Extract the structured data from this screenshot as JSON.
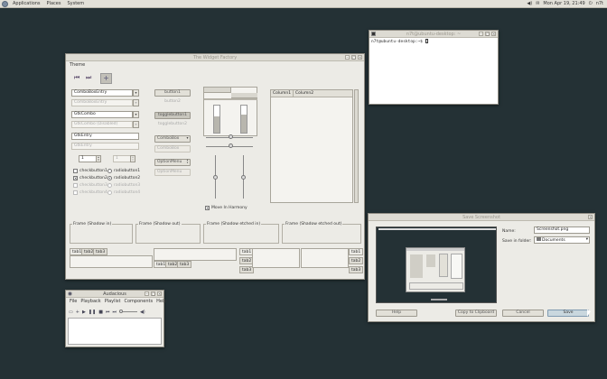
{
  "panel": {
    "menus": [
      "Applications",
      "Places",
      "System"
    ],
    "clock": "Mon Apr 19, 21:49",
    "user": "n7t"
  },
  "widget_factory": {
    "title": "The Widget Factory",
    "menu": "Theme",
    "combo_entry": "ComboBoxEntry",
    "combo_entry_dis": "ComboBoxEntry",
    "gtk_combo": "GtkCombo",
    "gtk_combo_dis": "GtkCombo (Disabled)",
    "gtk_entry": "GtkEntry",
    "gtk_entry_dis": "GtkEntry",
    "spin1": "1",
    "spin2": "1",
    "checks": [
      "checkbutton1",
      "checkbutton2",
      "checkbutton3",
      "checkbutton4"
    ],
    "radios": [
      "radiobutton1",
      "radiobutton2",
      "radiobutton3",
      "radiobutton4"
    ],
    "button1": "button1",
    "button2": "button2",
    "toggle1": "togglebutton1",
    "toggle2": "togglebutton2",
    "combobox": "ComboBox",
    "combobox_dis": "ComboBox",
    "option1": "OptionMenu",
    "option2": "OptionMenu",
    "move_harmony": "Move In Harmony",
    "col1": "Column1",
    "col2": "Column2",
    "frames": [
      "Frame (Shadow in)",
      "Frame (Shadow out)",
      "Frame (Shadow etched in)",
      "Frame (Shadow etched out)"
    ],
    "tabs": [
      "tab1",
      "tab2",
      "tab3"
    ]
  },
  "terminal": {
    "title": "n7t@ubuntu-desktop: ~",
    "prompt": "n7t@ubuntu-desktop:~$ "
  },
  "screenshot": {
    "title": "Save Screenshot",
    "name_label": "Name:",
    "name_value": "Screenshot.png",
    "folder_label": "Save in folder:",
    "folder_value": "Documents",
    "help": "Help",
    "copy": "Copy to Clipboard",
    "cancel": "Cancel",
    "save": "Save"
  },
  "audacious": {
    "title": "Audacious",
    "menus": [
      "File",
      "Playback",
      "Playlist",
      "Components",
      "Help"
    ]
  }
}
